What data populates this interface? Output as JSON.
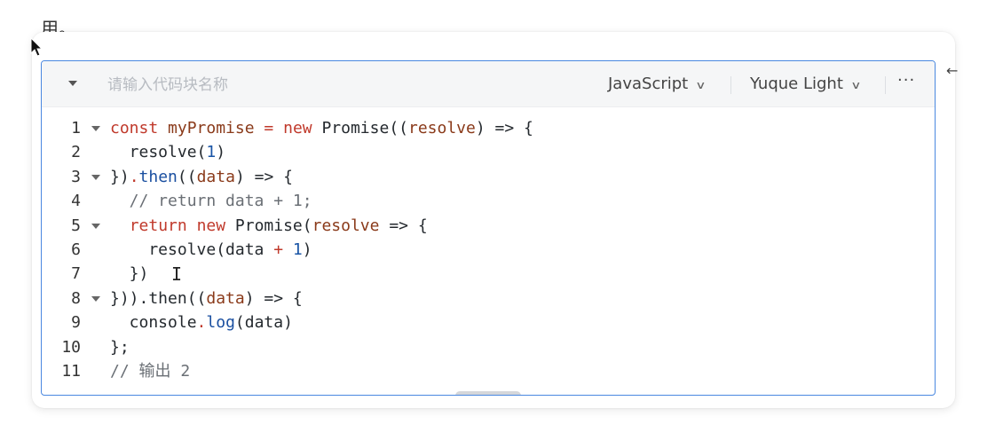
{
  "page_fragment": "用。",
  "code_block": {
    "name_placeholder": "请输入代码块名称",
    "language": "JavaScript",
    "theme": "Yuque Light",
    "more_label": "···"
  },
  "code_lines": [
    {
      "num": "1",
      "fold": true,
      "tokens": [
        [
          "k",
          "const "
        ],
        [
          "v",
          "myPromise"
        ],
        [
          "o",
          " "
        ],
        [
          "k",
          "="
        ],
        [
          "o",
          " "
        ],
        [
          "k",
          "new"
        ],
        [
          "o",
          " Promise(("
        ],
        [
          "v",
          "resolve"
        ],
        [
          "o",
          ") => {"
        ]
      ]
    },
    {
      "num": "2",
      "fold": false,
      "tokens": [
        [
          "o",
          "  resolve("
        ],
        [
          "n",
          "1"
        ],
        [
          "o",
          ")"
        ]
      ]
    },
    {
      "num": "3",
      "fold": true,
      "tokens": [
        [
          "o",
          "})"
        ],
        [
          "k",
          "."
        ],
        [
          "f",
          "then"
        ],
        [
          "o",
          "(("
        ],
        [
          "v",
          "data"
        ],
        [
          "o",
          ") => {"
        ]
      ]
    },
    {
      "num": "4",
      "fold": false,
      "tokens": [
        [
          "c",
          "  // return data + 1;"
        ]
      ]
    },
    {
      "num": "5",
      "fold": true,
      "tokens": [
        [
          "o",
          "  "
        ],
        [
          "k",
          "return"
        ],
        [
          "o",
          " "
        ],
        [
          "k",
          "new"
        ],
        [
          "o",
          " Promise("
        ],
        [
          "v",
          "resolve"
        ],
        [
          "o",
          " => {"
        ]
      ]
    },
    {
      "num": "6",
      "fold": false,
      "tokens": [
        [
          "o",
          "    resolve(data "
        ],
        [
          "k",
          "+"
        ],
        [
          "o",
          " "
        ],
        [
          "n",
          "1"
        ],
        [
          "o",
          ")"
        ]
      ]
    },
    {
      "num": "7",
      "fold": false,
      "tokens": [
        [
          "o",
          "  })"
        ]
      ]
    },
    {
      "num": "8",
      "fold": true,
      "tokens": [
        [
          "o",
          "})).then(("
        ],
        [
          "v",
          "data"
        ],
        [
          "o",
          ") => {"
        ]
      ]
    },
    {
      "num": "9",
      "fold": false,
      "tokens": [
        [
          "o",
          "  console"
        ],
        [
          "k",
          "."
        ],
        [
          "f",
          "log"
        ],
        [
          "o",
          "(data)"
        ]
      ]
    },
    {
      "num": "10",
      "fold": false,
      "tokens": [
        [
          "o",
          "};"
        ]
      ]
    },
    {
      "num": "11",
      "fold": false,
      "tokens": [
        [
          "c",
          "// 输出 2"
        ]
      ]
    }
  ]
}
